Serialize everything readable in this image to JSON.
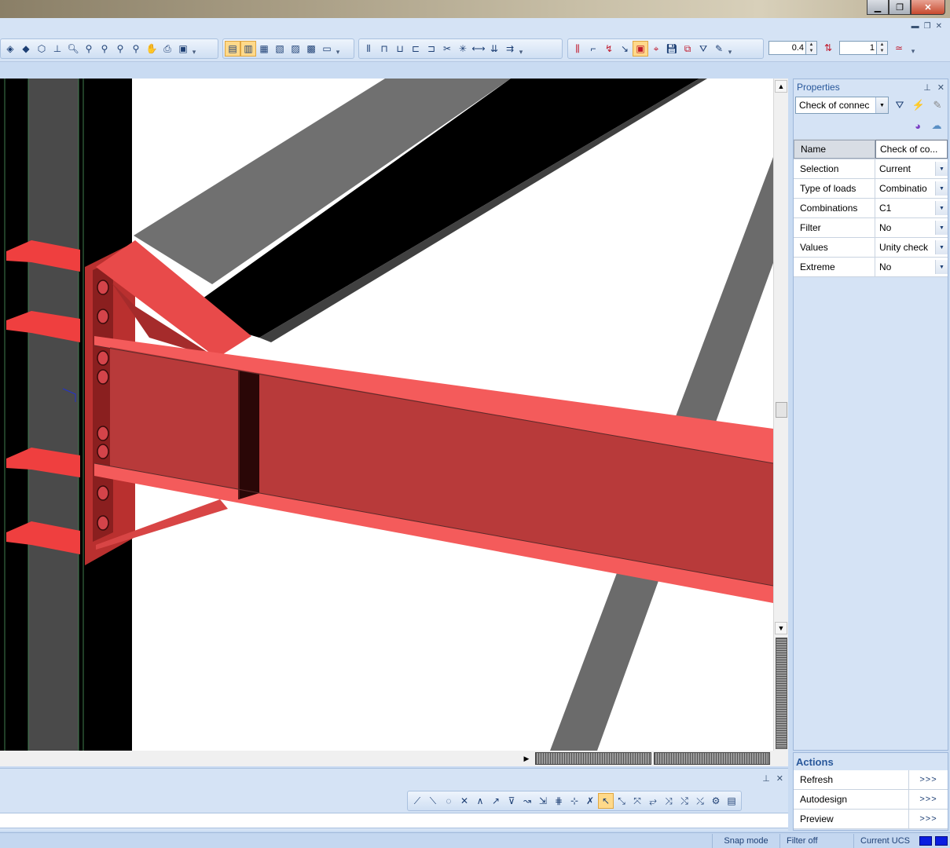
{
  "window": {
    "minimize_glyph": "▁",
    "maximize_glyph": "❐",
    "close_glyph": "✕"
  },
  "toolbar": {
    "zoom_value": "0.4",
    "step_value": "1"
  },
  "properties": {
    "title": "Properties",
    "filter_combo": "Check of connec",
    "rows": [
      {
        "label": "Name",
        "value": "Check of co..."
      },
      {
        "label": "Selection",
        "value": "Current"
      },
      {
        "label": "Type of loads",
        "value": "Combinatio"
      },
      {
        "label": "Combinations",
        "value": "C1"
      },
      {
        "label": "Filter",
        "value": "No"
      },
      {
        "label": "Values",
        "value": "Unity check"
      },
      {
        "label": "Extreme",
        "value": "No"
      }
    ]
  },
  "actions": {
    "title": "Actions",
    "items": [
      {
        "label": "Refresh",
        "go": ">>>"
      },
      {
        "label": "Autodesign",
        "go": ">>>"
      },
      {
        "label": "Preview",
        "go": ">>>"
      }
    ]
  },
  "statusbar": {
    "snap_mode": "Snap mode",
    "filter": "Filter off",
    "ucs": "Current UCS"
  },
  "colors": {
    "beam_red": "#e84a4a",
    "column_black": "#000000",
    "purlin_grey": "#6b6b6b",
    "indicator_blue": "#0a1de0"
  }
}
